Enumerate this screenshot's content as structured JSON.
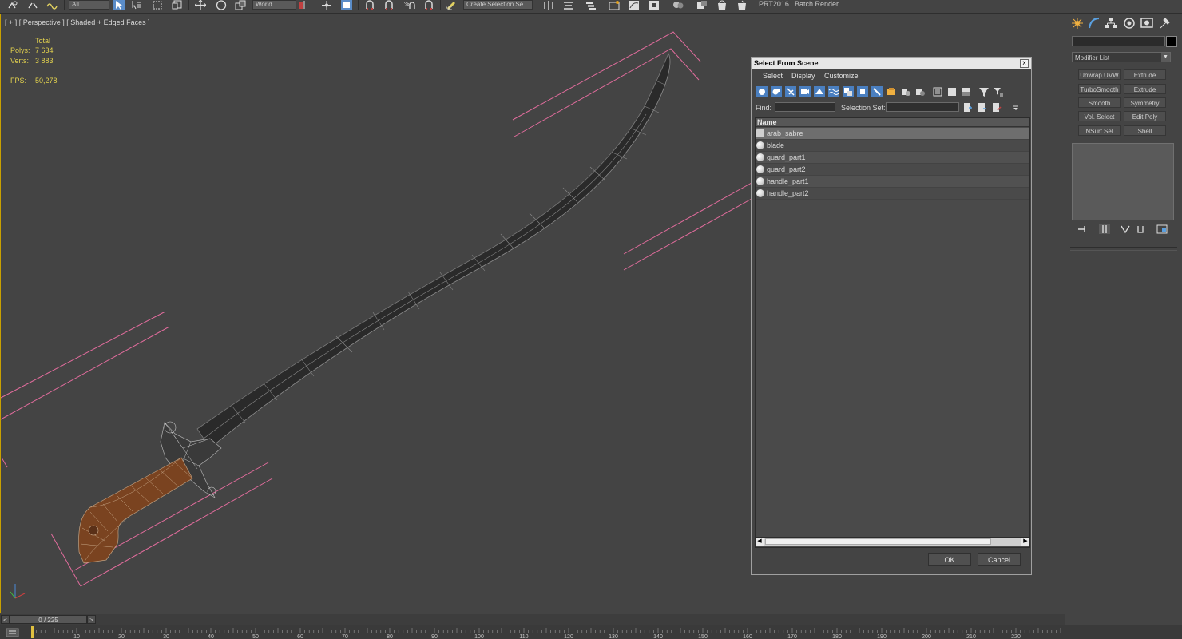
{
  "toolbar": {
    "selection_filter": "All",
    "reference_coord": "World",
    "named_selection_placeholder": "Create Selection Se",
    "prt_label": "PRT2016",
    "batch_render_label": "Batch Render..."
  },
  "viewport": {
    "label": "[ + ] [ Perspective ] [ Shaded + Edged Faces ]",
    "stats": {
      "total_label": "Total",
      "polys_label": "Polys:",
      "polys_value": "7 634",
      "verts_label": "Verts:",
      "verts_value": "3 883",
      "fps_label": "FPS:",
      "fps_value": "50,278"
    }
  },
  "command_panel": {
    "modifier_list_label": "Modifier List",
    "modifier_buttons": [
      "Unwrap UVW",
      "Extrude",
      "TurboSmooth",
      "Extrude",
      "Smooth",
      "Symmetry",
      "Vol. Select",
      "Edit Poly",
      "NSurf Sel",
      "Shell"
    ]
  },
  "dialog": {
    "title": "Select From Scene",
    "close": "x",
    "menu": [
      "Select",
      "Display",
      "Customize"
    ],
    "find_label": "Find:",
    "find_value": "",
    "selection_set_label": "Selection Set:",
    "selection_set_value": "",
    "list_header": "Name",
    "rows": [
      "arab_sabre",
      "blade",
      "guard_part1",
      "guard_part2",
      "handle_part1",
      "handle_part2"
    ],
    "ok_label": "OK",
    "cancel_label": "Cancel"
  },
  "time_slider": {
    "position": "0 / 225",
    "prev": "<",
    "next": ">"
  },
  "track_bar": {
    "ticks": [
      "10",
      "20",
      "30",
      "40",
      "50",
      "60",
      "70",
      "80",
      "90",
      "100",
      "110",
      "120",
      "130",
      "140",
      "150",
      "160",
      "170",
      "180",
      "190",
      "200",
      "210",
      "220"
    ]
  },
  "colors": {
    "viewport_bg": "#444444",
    "viewport_border": "#c8a000",
    "stats_text": "#e3d24e",
    "blade": "#2a2a2a",
    "handle_wood": "#7a4320",
    "bbox_lines": "#e06c9c",
    "dialog_title_bg": "#e6e6e6"
  }
}
